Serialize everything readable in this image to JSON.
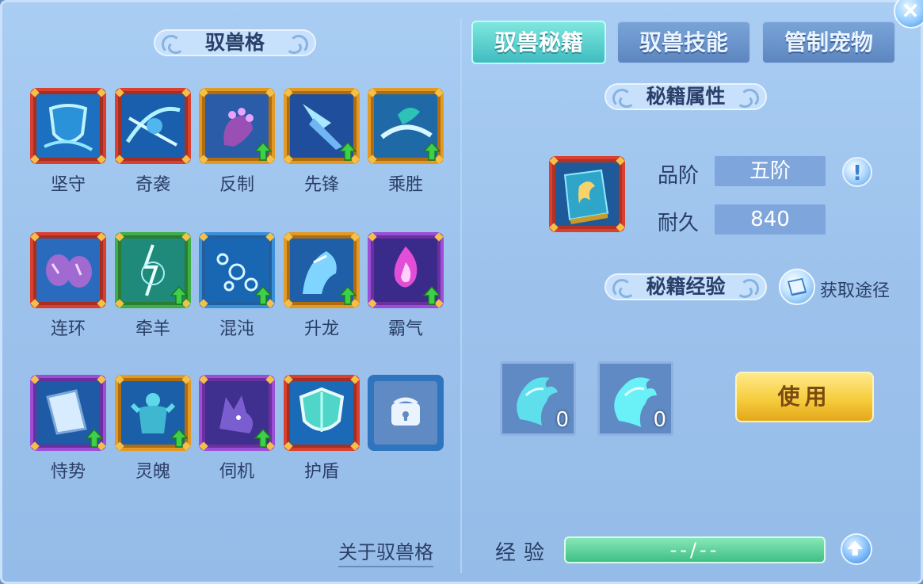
{
  "left_panel": {
    "title": "驭兽格",
    "about_link": "关于驭兽格",
    "slots": [
      {
        "label": "坚守",
        "frame": "red",
        "art": "shield",
        "upgrade": false
      },
      {
        "label": "奇袭",
        "frame": "red",
        "art": "slash",
        "upgrade": false
      },
      {
        "label": "反制",
        "frame": "orange",
        "art": "claw",
        "upgrade": true
      },
      {
        "label": "先锋",
        "frame": "orange",
        "art": "spear",
        "upgrade": true
      },
      {
        "label": "乘胜",
        "frame": "orange",
        "art": "horn",
        "upgrade": true
      },
      {
        "label": "连环",
        "frame": "red",
        "art": "claws",
        "upgrade": false
      },
      {
        "label": "牵羊",
        "frame": "green",
        "art": "lightning",
        "upgrade": true
      },
      {
        "label": "混沌",
        "frame": "blue",
        "art": "bubbles",
        "upgrade": true
      },
      {
        "label": "升龙",
        "frame": "orange",
        "art": "dragon",
        "upgrade": true
      },
      {
        "label": "霸气",
        "frame": "purple",
        "art": "flame",
        "upgrade": true
      },
      {
        "label": "恃势",
        "frame": "purple",
        "art": "blade",
        "upgrade": true
      },
      {
        "label": "灵魄",
        "frame": "orange",
        "art": "titan",
        "upgrade": true
      },
      {
        "label": "伺机",
        "frame": "purple",
        "art": "wolf",
        "upgrade": true
      },
      {
        "label": "护盾",
        "frame": "red",
        "art": "guard",
        "upgrade": false
      },
      {
        "label": "",
        "frame": "locked",
        "art": "lock",
        "upgrade": false
      }
    ]
  },
  "tabs": [
    {
      "label": "驭兽秘籍",
      "active": true
    },
    {
      "label": "驭兽技能",
      "active": false
    },
    {
      "label": "管制宠物",
      "active": false
    }
  ],
  "attributes": {
    "title": "秘籍属性",
    "grade_label": "品阶",
    "grade_value": "五阶",
    "durability_label": "耐久",
    "durability_value": "840",
    "info_glyph": "!"
  },
  "experience": {
    "title": "秘籍经验",
    "acquire_label": "获取途径",
    "items": [
      {
        "icon": "spirit-horse-icon",
        "count": "0"
      },
      {
        "icon": "spirit-horse-icon",
        "count": "0"
      }
    ],
    "use_button": "使用",
    "bar_label": "经验",
    "bar_value": "--/--"
  },
  "colors": {
    "frame_red": "#d8412f",
    "frame_orange": "#e39a25",
    "frame_green": "#3fae47",
    "frame_blue": "#3a8fd9",
    "frame_purple": "#9b4fd6",
    "tab_active": "#4fcac8",
    "use_button": "#f4c83a"
  }
}
